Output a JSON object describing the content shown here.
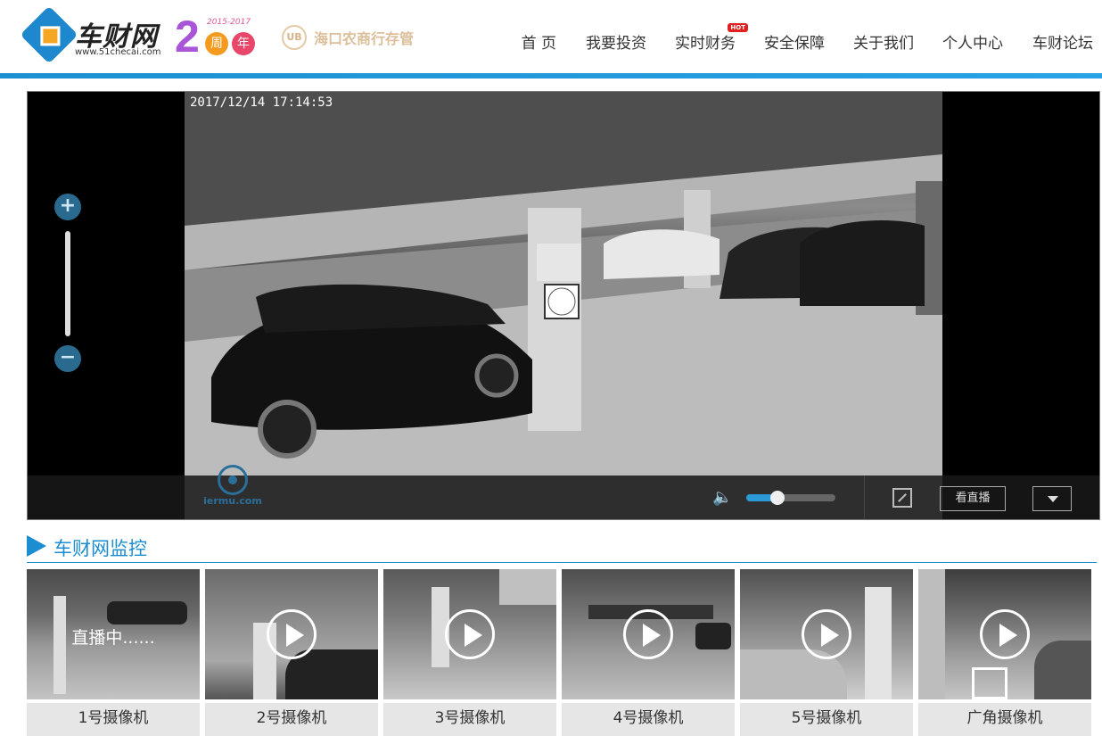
{
  "header": {
    "logo_text": "车财网",
    "logo_url": "www.51checai.com",
    "anniversary_digit": "2",
    "anniversary_years": "2015-2017",
    "anniversary_char1": "周",
    "anniversary_char2": "年",
    "bank_icon_text": "UB",
    "bank_text": "海口农商行存管"
  },
  "nav": {
    "items": [
      {
        "label": "首 页"
      },
      {
        "label": "我要投资"
      },
      {
        "label": "实时财务",
        "badge": "HOT"
      },
      {
        "label": "安全保障"
      },
      {
        "label": "关于我们"
      },
      {
        "label": "个人中心"
      },
      {
        "label": "车财论坛"
      }
    ]
  },
  "player": {
    "timestamp": "2017/12/14  17:14:53",
    "zoom_in": "+",
    "zoom_out": "−",
    "watermark": "iermu.com",
    "volume_level": 0.35,
    "live_button": "看直播",
    "accent_color": "#2a9bd6"
  },
  "section": {
    "title": "车财网监控",
    "color": "#1c8dd0"
  },
  "cameras": [
    {
      "label": "1号摄像机",
      "status": "直播中......"
    },
    {
      "label": "2号摄像机"
    },
    {
      "label": "3号摄像机"
    },
    {
      "label": "4号摄像机"
    },
    {
      "label": "5号摄像机"
    },
    {
      "label": "广角摄像机"
    }
  ]
}
